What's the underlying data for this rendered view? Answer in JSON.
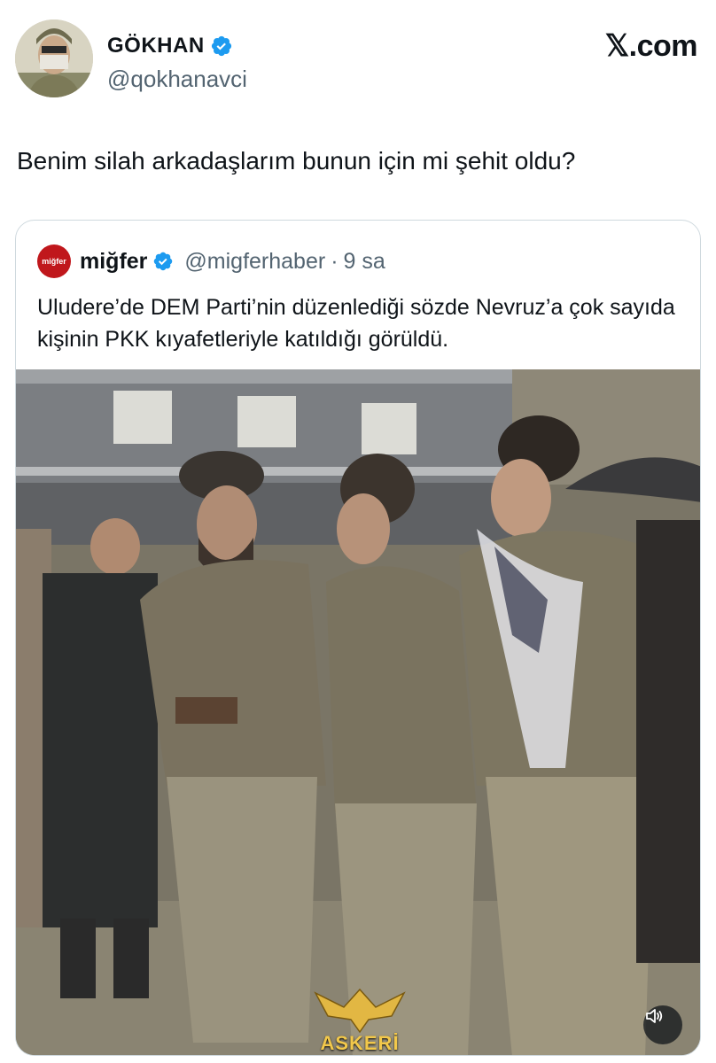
{
  "author": {
    "name": "GÖKHAN",
    "handle": "@qokhanavci",
    "avatar_icon": "profile-photo-icon",
    "verified_icon": "verified-badge-icon"
  },
  "site": "𝕏.com",
  "tweet": {
    "text": "Benim silah arkadaşlarım bunun için mi şehit oldu?"
  },
  "quote": {
    "logo_text": "miğfer",
    "name": "miğfer",
    "handle": "@migferhaber",
    "separator": "·",
    "time": "9 sa",
    "text": "Uludere’de DEM Parti’nin düzenlediği sözde Nevruz’a çok sayıda kişinin PKK kıyafetleriyle katıldığı görüldü.",
    "media": {
      "watermark": "ASKERİ",
      "mute_icon": "speaker-icon"
    }
  },
  "colors": {
    "text": "#0f1419",
    "secondary": "#536471",
    "verified": "#1d9bf0",
    "border": "#cfd9de",
    "logo": "#c0171c"
  }
}
